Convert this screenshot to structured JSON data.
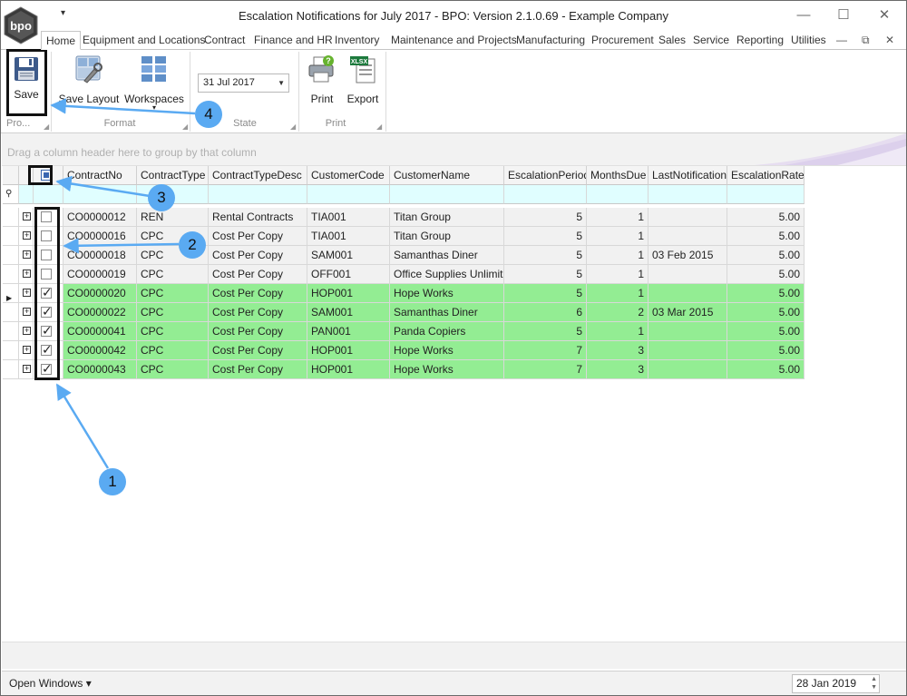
{
  "window": {
    "title": "Escalation Notifications for July 2017 - BPO: Version 2.1.0.69 - Example Company",
    "logo_text": "bpo",
    "qat_glyph": "▾",
    "minimize": "—",
    "maximize": "☐",
    "close": "✕"
  },
  "tabs": [
    "Home",
    "Equipment and Locations",
    "Contract",
    "Finance and HR",
    "Inventory",
    "Maintenance and Projects",
    "Manufacturing",
    "Procurement",
    "Sales",
    "Service",
    "Reporting",
    "Utilities"
  ],
  "mdi": {
    "minimize": "—",
    "restore": "⧉",
    "close": "✕"
  },
  "ribbon": {
    "save_label": "Save",
    "group_process": "Pro...",
    "save_layout_label": "Save Layout",
    "workspaces_label": "Workspaces",
    "workspaces_arrow": "▾",
    "group_format": "Format",
    "state_date": "31 Jul 2017",
    "state_arrow": "▼",
    "group_state": "State",
    "print_label": "Print",
    "export_label": "Export",
    "export_badge": "XLSX",
    "group_print": "Print"
  },
  "grouppanel_hint": "Drag a column header here to group by that column",
  "grid": {
    "columns": [
      "ContractNo",
      "ContractType",
      "ContractTypeDesc",
      "CustomerCode",
      "CustomerName",
      "EscalationPeriod",
      "MonthsDue",
      "LastNotification",
      "EscalationRate"
    ],
    "filter_glyph": "⚲",
    "row_indicator": "▶",
    "expand_glyph": "+",
    "rows": [
      {
        "checked": false,
        "ContractNo": "CO0000012",
        "ContractType": "REN",
        "ContractTypeDesc": "Rental Contracts",
        "CustomerCode": "TIA001",
        "CustomerName": "Titan Group",
        "EscalationPeriod": "5",
        "MonthsDue": "1",
        "LastNotification": "",
        "EscalationRate": "5.00"
      },
      {
        "checked": false,
        "ContractNo": "CO0000016",
        "ContractType": "CPC",
        "ContractTypeDesc": "Cost Per Copy",
        "CustomerCode": "TIA001",
        "CustomerName": "Titan Group",
        "EscalationPeriod": "5",
        "MonthsDue": "1",
        "LastNotification": "",
        "EscalationRate": "5.00"
      },
      {
        "checked": false,
        "ContractNo": "CO0000018",
        "ContractType": "CPC",
        "ContractTypeDesc": "Cost Per Copy",
        "CustomerCode": "SAM001",
        "CustomerName": "Samanthas Diner",
        "EscalationPeriod": "5",
        "MonthsDue": "1",
        "LastNotification": "03 Feb 2015",
        "EscalationRate": "5.00"
      },
      {
        "checked": false,
        "ContractNo": "CO0000019",
        "ContractType": "CPC",
        "ContractTypeDesc": "Cost Per Copy",
        "CustomerCode": "OFF001",
        "CustomerName": "Office Supplies Unlimited",
        "EscalationPeriod": "5",
        "MonthsDue": "1",
        "LastNotification": "",
        "EscalationRate": "5.00"
      },
      {
        "checked": true,
        "ContractNo": "CO0000020",
        "ContractType": "CPC",
        "ContractTypeDesc": "Cost Per Copy",
        "CustomerCode": "HOP001",
        "CustomerName": "Hope Works",
        "EscalationPeriod": "5",
        "MonthsDue": "1",
        "LastNotification": "",
        "EscalationRate": "5.00"
      },
      {
        "checked": true,
        "ContractNo": "CO0000022",
        "ContractType": "CPC",
        "ContractTypeDesc": "Cost Per Copy",
        "CustomerCode": "SAM001",
        "CustomerName": "Samanthas Diner",
        "EscalationPeriod": "6",
        "MonthsDue": "2",
        "LastNotification": "03 Mar 2015",
        "EscalationRate": "5.00"
      },
      {
        "checked": true,
        "ContractNo": "CO0000041",
        "ContractType": "CPC",
        "ContractTypeDesc": "Cost Per Copy",
        "CustomerCode": "PAN001",
        "CustomerName": "Panda Copiers",
        "EscalationPeriod": "5",
        "MonthsDue": "1",
        "LastNotification": "",
        "EscalationRate": "5.00"
      },
      {
        "checked": true,
        "ContractNo": "CO0000042",
        "ContractType": "CPC",
        "ContractTypeDesc": "Cost Per Copy",
        "CustomerCode": "HOP001",
        "CustomerName": "Hope Works",
        "EscalationPeriod": "7",
        "MonthsDue": "3",
        "LastNotification": "",
        "EscalationRate": "5.00"
      },
      {
        "checked": true,
        "ContractNo": "CO0000043",
        "ContractType": "CPC",
        "ContractTypeDesc": "Cost Per Copy",
        "CustomerCode": "HOP001",
        "CustomerName": "Hope Works",
        "EscalationPeriod": "7",
        "MonthsDue": "3",
        "LastNotification": "",
        "EscalationRate": "5.00"
      }
    ]
  },
  "annotations": {
    "c1": "1",
    "c2": "2",
    "c3": "3",
    "c4": "4"
  },
  "statusbar": {
    "open_windows": "Open Windows ▾",
    "date": "28 Jan 2019",
    "spin_up": "▲",
    "spin_down": "▼"
  },
  "colors": {
    "checked_row": "#93ed93",
    "filter_row": "#e0feff",
    "callout": "#5aaaf2",
    "arrow": "#5aaaf2"
  }
}
